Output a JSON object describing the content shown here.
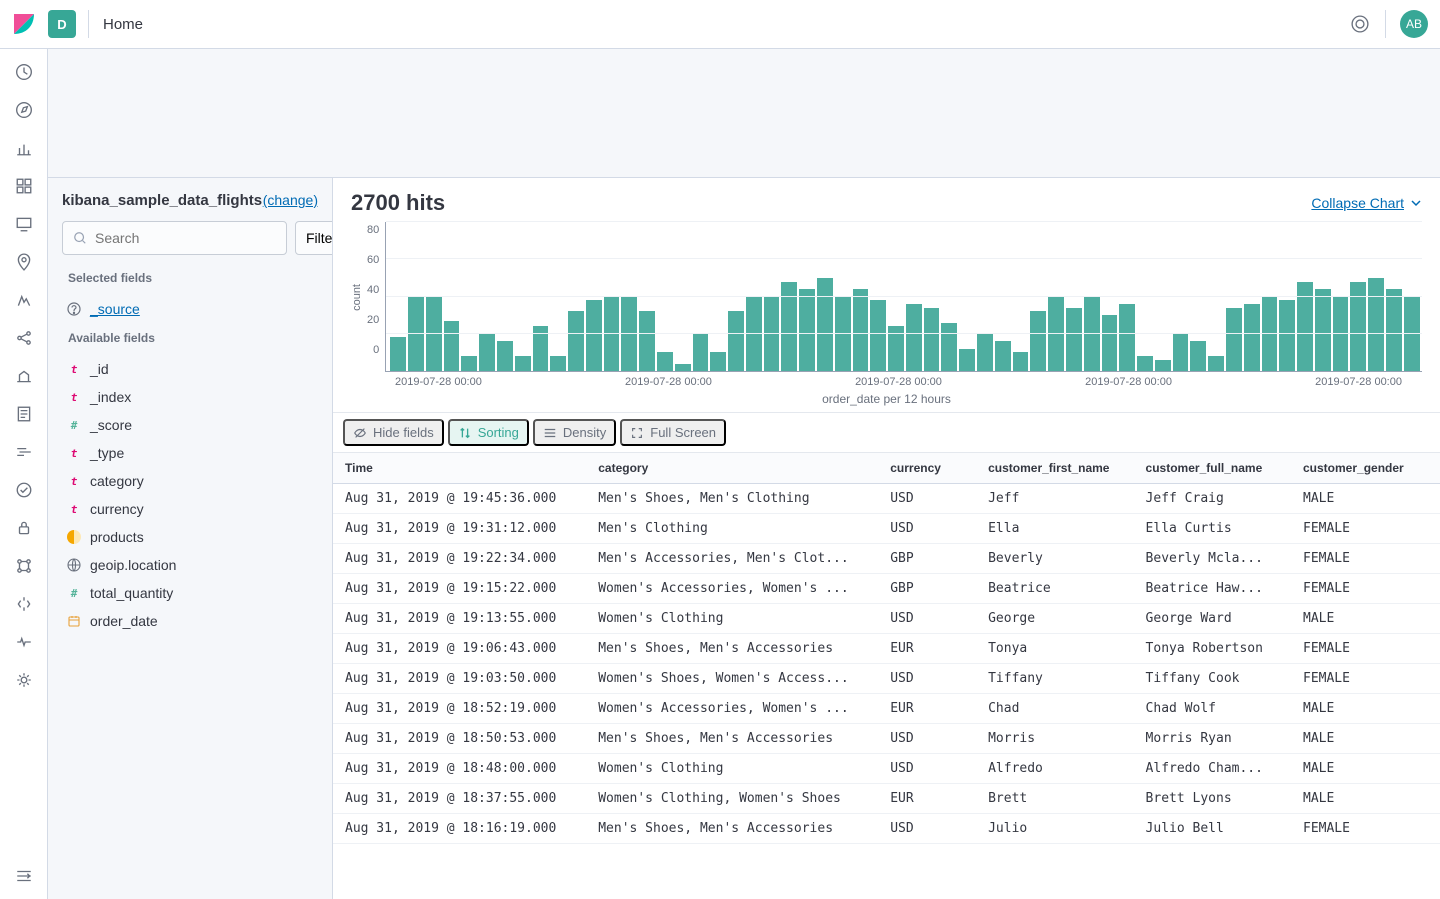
{
  "header": {
    "space_initial": "D",
    "breadcrumb": "Home",
    "avatar_initials": "AB"
  },
  "sidebar": {
    "index_name": "kibana_sample_data_flights",
    "change_label": "(change)",
    "search_placeholder": "Search",
    "filter_label": "Filter",
    "selected_label": "Selected fields",
    "available_label": "Available fields",
    "source_field": "_source",
    "available": [
      {
        "type": "t",
        "name": "_id"
      },
      {
        "type": "t",
        "name": "_index"
      },
      {
        "type": "num",
        "name": "_score"
      },
      {
        "type": "t",
        "name": "_type"
      },
      {
        "type": "t",
        "name": "category"
      },
      {
        "type": "t",
        "name": "currency"
      },
      {
        "type": "half",
        "name": "products"
      },
      {
        "type": "globe",
        "name": "geoip.location"
      },
      {
        "type": "num",
        "name": "total_quantity"
      },
      {
        "type": "cal",
        "name": "order_date"
      }
    ]
  },
  "content": {
    "hits_title": "2700 hits",
    "collapse_label": "Collapse Chart",
    "chart": {
      "ylabel": "count",
      "xlabel": "order_date per 12 hours",
      "ymax": 80
    },
    "controls": {
      "hide_fields": "Hide fields",
      "sorting": "Sorting",
      "density": "Density",
      "full_screen": "Full Screen"
    },
    "columns": [
      "Time",
      "category",
      "currency",
      "customer_first_name",
      "customer_full_name",
      "customer_gender"
    ],
    "rows": [
      {
        "time": "Aug 31, 2019 @ 19:45:36.000",
        "category": "Men's Shoes, Men's Clothing",
        "currency": "USD",
        "first": "Jeff",
        "full": "Jeff Craig",
        "gender": "MALE"
      },
      {
        "time": "Aug 31, 2019 @ 19:31:12.000",
        "category": "Men's Clothing",
        "currency": "USD",
        "first": "Ella",
        "full": "Ella Curtis",
        "gender": "FEMALE"
      },
      {
        "time": "Aug 31, 2019 @ 19:22:34.000",
        "category": "Men's Accessories, Men's Clot...",
        "currency": "GBP",
        "first": "Beverly",
        "full": "Beverly Mcla...",
        "gender": "FEMALE"
      },
      {
        "time": "Aug 31, 2019 @ 19:15:22.000",
        "category": "Women's Accessories, Women's ...",
        "currency": "GBP",
        "first": "Beatrice",
        "full": "Beatrice Haw...",
        "gender": "FEMALE"
      },
      {
        "time": "Aug 31, 2019 @ 19:13:55.000",
        "category": "Women's Clothing",
        "currency": "USD",
        "first": "George",
        "full": "George Ward",
        "gender": "MALE"
      },
      {
        "time": "Aug 31, 2019 @ 19:06:43.000",
        "category": "Men's Shoes, Men's Accessories",
        "currency": "EUR",
        "first": "Tonya",
        "full": "Tonya Robertson",
        "gender": "FEMALE"
      },
      {
        "time": "Aug 31, 2019 @ 19:03:50.000",
        "category": "Women's Shoes, Women's Access...",
        "currency": "USD",
        "first": "Tiffany",
        "full": "Tiffany Cook",
        "gender": "FEMALE"
      },
      {
        "time": "Aug 31, 2019 @ 18:52:19.000",
        "category": "Women's Accessories, Women's ...",
        "currency": "EUR",
        "first": "Chad",
        "full": "Chad Wolf",
        "gender": "MALE"
      },
      {
        "time": "Aug 31, 2019 @ 18:50:53.000",
        "category": "Men's Shoes, Men's Accessories",
        "currency": "USD",
        "first": "Morris",
        "full": "Morris Ryan",
        "gender": "MALE"
      },
      {
        "time": "Aug 31, 2019 @ 18:48:00.000",
        "category": "Women's Clothing",
        "currency": "USD",
        "first": "Alfredo",
        "full": "Alfredo Cham...",
        "gender": "MALE"
      },
      {
        "time": "Aug 31, 2019 @ 18:37:55.000",
        "category": "Women's Clothing, Women's Shoes",
        "currency": "EUR",
        "first": "Brett",
        "full": "Brett Lyons",
        "gender": "MALE"
      },
      {
        "time": "Aug 31, 2019 @ 18:16:19.000",
        "category": "Men's Shoes, Men's Accessories",
        "currency": "USD",
        "first": "Julio",
        "full": "Julio Bell",
        "gender": "FEMALE"
      }
    ]
  },
  "chart_data": {
    "type": "bar",
    "ylabel": "count",
    "xlabel": "order_date per 12 hours",
    "ylim": [
      0,
      80
    ],
    "xticks": [
      "2019-07-28 00:00",
      "2019-07-28 00:00",
      "2019-07-28 00:00",
      "2019-07-28 00:00",
      "2019-07-28 00:00"
    ],
    "yticks": [
      0,
      20,
      40,
      60,
      80
    ],
    "values": [
      18,
      40,
      40,
      27,
      8,
      20,
      16,
      8,
      24,
      8,
      32,
      38,
      40,
      40,
      32,
      10,
      4,
      20,
      10,
      32,
      40,
      40,
      48,
      44,
      50,
      40,
      44,
      38,
      24,
      36,
      34,
      26,
      12,
      20,
      16,
      10,
      32,
      40,
      34,
      40,
      30,
      36,
      8,
      6,
      20,
      16,
      8,
      34,
      36,
      40,
      38,
      48,
      44,
      40,
      48,
      50,
      44,
      40
    ]
  }
}
